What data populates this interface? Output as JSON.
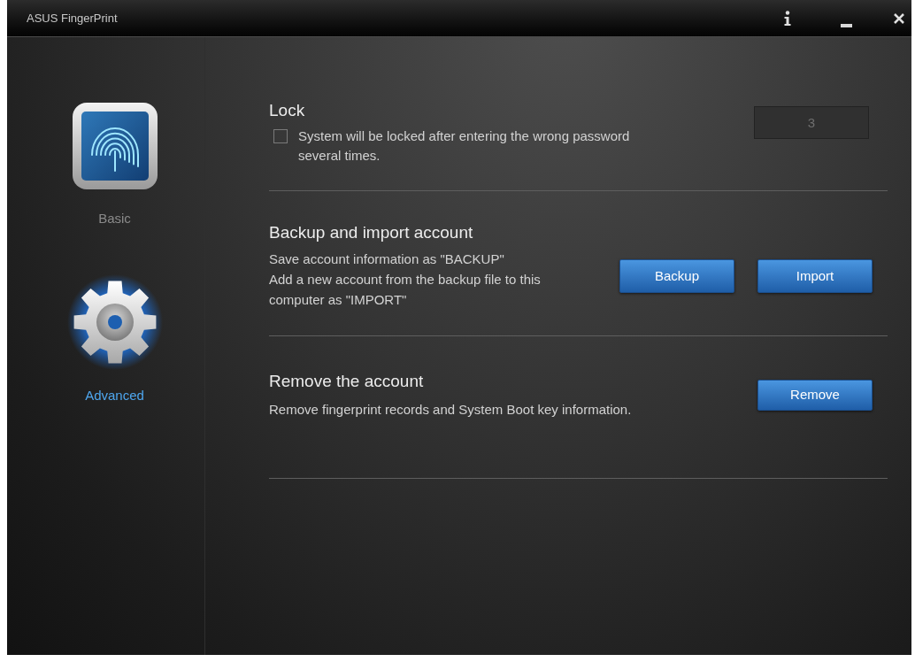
{
  "window": {
    "title": "ASUS FingerPrint"
  },
  "sidebar": {
    "items": [
      {
        "kind": "fingerprint",
        "label": "Basic",
        "selected": false
      },
      {
        "kind": "gear",
        "label": "Advanced",
        "selected": true
      }
    ]
  },
  "sections": [
    {
      "kind": "lock",
      "title": "Lock",
      "checkbox": {
        "label": "System will be locked after entering the wrong password several times.",
        "checked": false
      },
      "field": {
        "value": "3",
        "disabled": true
      }
    },
    {
      "kind": "backup",
      "title": "Backup and import account",
      "description": [
        "Save account information as \"BACKUP\"",
        "Add a new account from the backup file to this computer as \"IMPORT\""
      ],
      "buttons": [
        "Backup",
        "Import"
      ]
    },
    {
      "kind": "remove",
      "title": "Remove the account",
      "description": [
        "Remove fingerprint records and System Boot key information."
      ],
      "buttons": [
        "Remove"
      ]
    }
  ]
}
